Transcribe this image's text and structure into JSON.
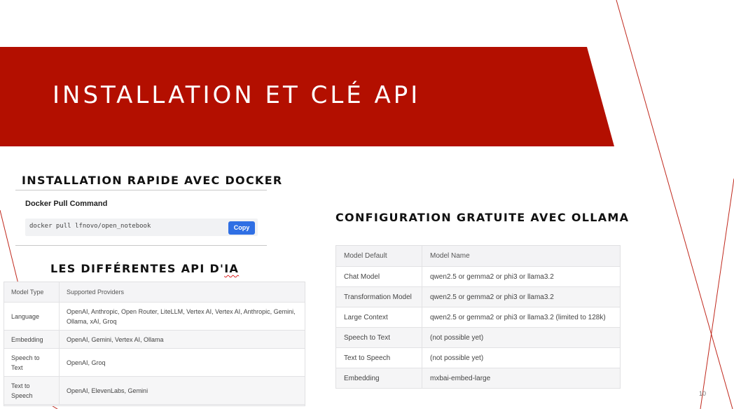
{
  "slide": {
    "title": "INSTALLATION ET CLÉ API",
    "page_number": "10",
    "colors": {
      "banner": "#b30f00",
      "accent_line": "#c0281c",
      "copy_button": "#2f6fe4"
    }
  },
  "docker_section": {
    "heading": "Installation rapide avec Docker",
    "label": "Docker Pull Command",
    "command": "docker pull lfnovo/open_notebook",
    "copy_label": "Copy"
  },
  "api_section": {
    "heading_prefix": "Les différentes ",
    "heading_api": "API",
    "heading_suffix": " d'",
    "heading_misspelled": "IA",
    "columns": [
      "Model Type",
      "Supported Providers"
    ],
    "rows": [
      {
        "type": "Language",
        "providers": "OpenAI, Anthropic, Open Router, LiteLLM, Vertex AI, Vertex AI, Anthropic, Gemini, Ollama, xAI, Groq"
      },
      {
        "type": "Embedding",
        "providers": "OpenAI, Gemini, Vertex AI, Ollama"
      },
      {
        "type": "Speech to Text",
        "providers": "OpenAI, Groq"
      },
      {
        "type": "Text to Speech",
        "providers": "OpenAI, ElevenLabs, Gemini"
      }
    ]
  },
  "ollama_section": {
    "heading": "Configuration gratuite avec Ollama",
    "columns": [
      "Model Default",
      "Model Name"
    ],
    "rows": [
      {
        "default": "Chat Model",
        "name": "qwen2.5 or gemma2 or phi3 or llama3.2"
      },
      {
        "default": "Transformation Model",
        "name": "qwen2.5 or gemma2 or phi3 or llama3.2"
      },
      {
        "default": "Large Context",
        "name": "qwen2.5 or gemma2 or phi3 or llama3.2 (limited to 128k)"
      },
      {
        "default": "Speech to Text",
        "name": "(not possible yet)"
      },
      {
        "default": "Text to Speech",
        "name": "(not possible yet)"
      },
      {
        "default": "Embedding",
        "name": "mxbai-embed-large"
      }
    ]
  }
}
